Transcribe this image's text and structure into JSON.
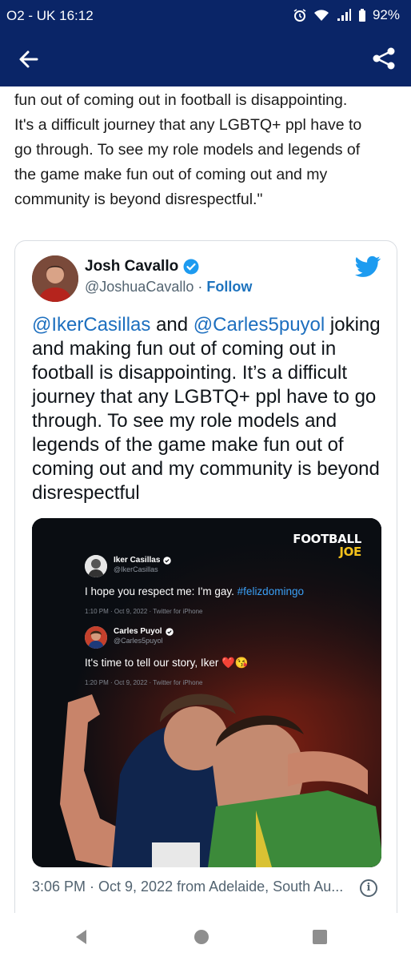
{
  "status_bar": {
    "carrier_time": "O2 - UK 16:12",
    "battery": "92%"
  },
  "article": {
    "quote_lines": [
      "fun out of coming out in football is disappointing.",
      "It's a difficult journey that any LGBTQ+ ppl have to",
      "go through. To see my role models and legends of",
      "the game make fun out of coming out and my",
      "community is beyond disrespectful.\""
    ]
  },
  "tweet": {
    "author_name": "Josh Cavallo",
    "handle": "@JoshuaCavallo",
    "separator": " · ",
    "follow_label": "Follow",
    "mention_1": "@IkerCasillas",
    "and_word": " and ",
    "mention_2": "@Carles5puyol",
    "text_rest": " joking and making fun out of coming out in football is disappointing. It’s a difficult journey that any LGBTQ+ ppl have to go through. To see my role models and legends of the game make fun out of coming out and my community is beyond disrespectful",
    "footer": "3:06 PM · Oct 9, 2022 from Adelaide, South Au...",
    "info_icon_label": "i"
  },
  "media": {
    "brand_line_1": "FOOTBALL",
    "brand_line_2": "JOE",
    "tweet1": {
      "name": "Iker Casillas",
      "handle": "@IkerCasillas",
      "text": "I hope you respect me: I'm gay. ",
      "hashtag": "#felizdomingo",
      "meta": "1:10 PM · Oct 9, 2022 · Twitter for iPhone"
    },
    "tweet2": {
      "name": "Carles Puyol",
      "handle": "@Carles5puyol",
      "text": "It's time to tell our story, Iker ",
      "emoji": "❤️😘",
      "meta": "1:20 PM · Oct 9, 2022 · Twitter for iPhone"
    }
  },
  "colors": {
    "app_bar": "#0a2567",
    "link": "#1d6fbf",
    "twitter_blue": "#1d9bf0",
    "brand_yellow": "#f4c21c"
  },
  "icons": [
    "back-arrow-icon",
    "share-icon",
    "verified-badge-icon",
    "twitter-bird-icon",
    "info-icon",
    "nav-back-icon",
    "nav-home-icon",
    "nav-recents-icon"
  ]
}
